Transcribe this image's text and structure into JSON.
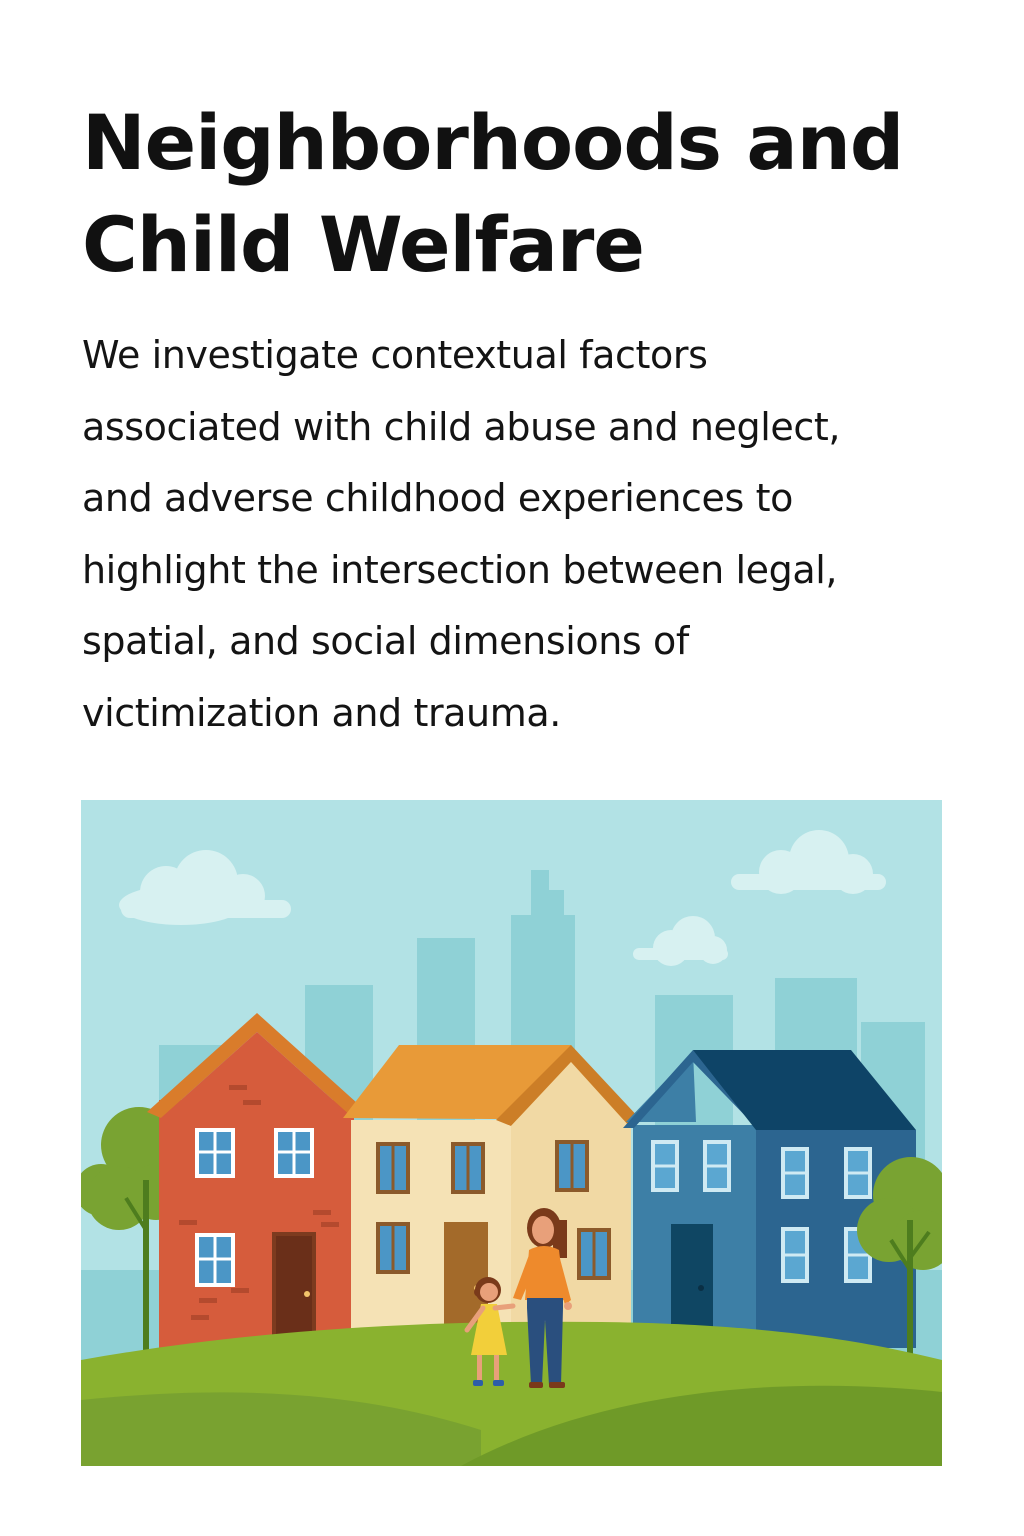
{
  "title": {
    "lines": [
      "Neighborhoods and",
      "Child Welfare"
    ]
  },
  "description": {
    "lines": [
      "We investigate contextual factors",
      "associated with child abuse and neglect,",
      "and adverse childhood experiences to",
      "highlight the intersection between legal,",
      "spatial, and social dimensions of",
      "victimization and trauma."
    ]
  },
  "illustration": {
    "sky_color": "#b2e2e5",
    "skyline_color": "#8fd1d6",
    "grass_color": "#8ab22f",
    "houses": [
      {
        "name": "red-house",
        "wall": "#d65c3c",
        "roof": "#d97c2b"
      },
      {
        "name": "cream-house",
        "wall": "#f5e2b5",
        "roof": "#e89a38"
      },
      {
        "name": "blue-house",
        "wall": "#3d7fa6",
        "roof": "#0e4467"
      }
    ],
    "people": [
      "mother",
      "daughter"
    ]
  }
}
